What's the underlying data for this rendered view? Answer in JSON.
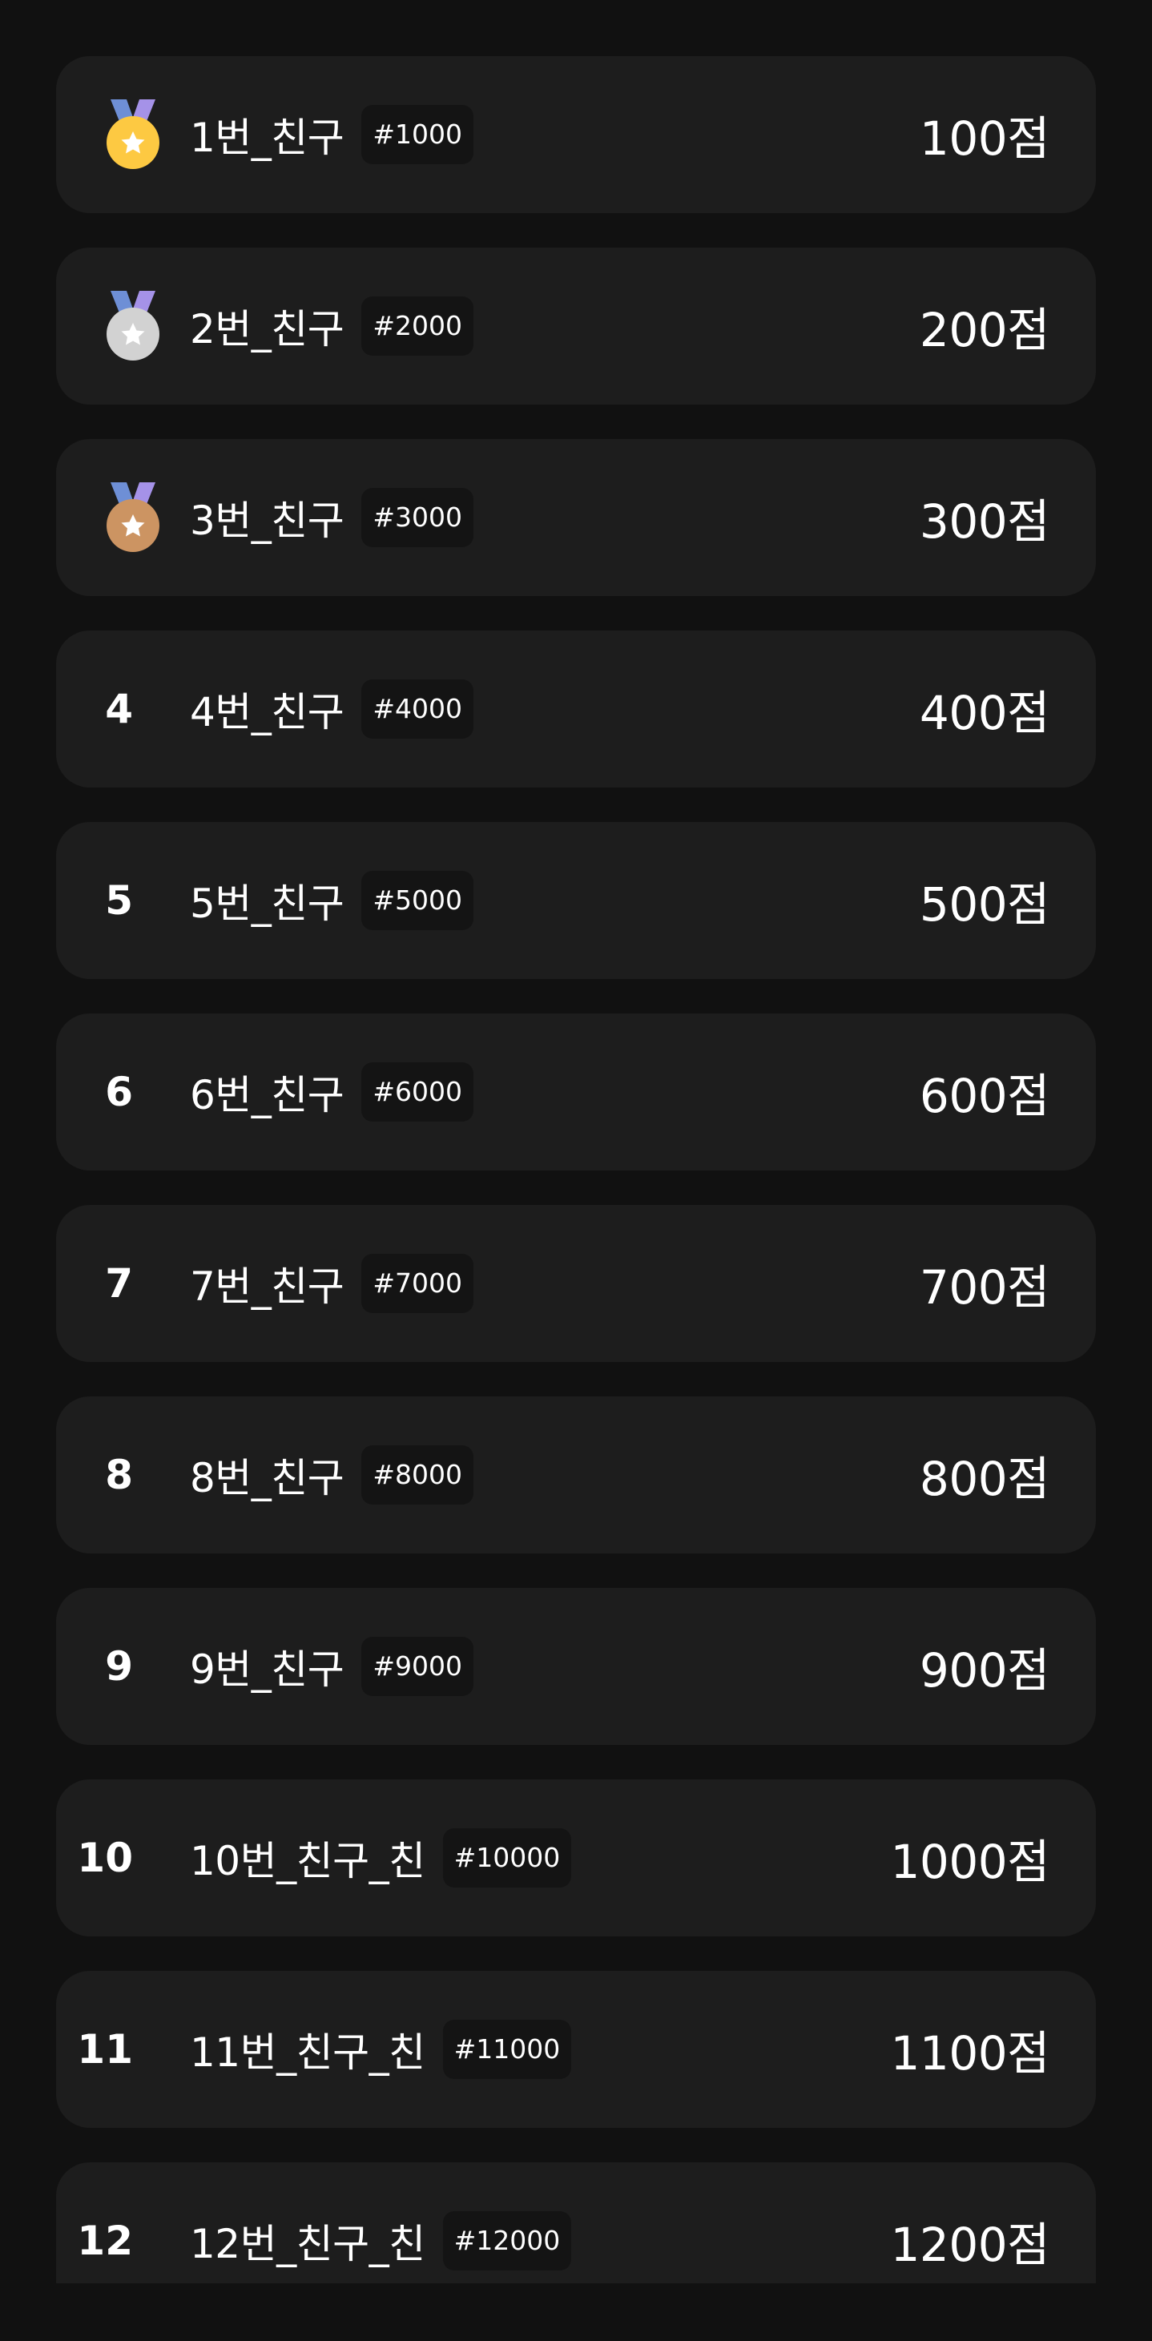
{
  "colors": {
    "background": "#111111",
    "row_background": "#1d1d1d",
    "tag_background": "#141414",
    "text": "#ffffff",
    "gold": "#fdc942",
    "silver": "#d2d2d2",
    "bronze": "#cc9462",
    "ribbon_left": "#6e8fd6",
    "ribbon_right": "#a592e8"
  },
  "leaderboard": {
    "entries": [
      {
        "rank": "1",
        "medal": "gold-medal-icon",
        "name": "1번_친구",
        "tag": "#1000",
        "score": "100점"
      },
      {
        "rank": "2",
        "medal": "silver-medal-icon",
        "name": "2번_친구",
        "tag": "#2000",
        "score": "200점"
      },
      {
        "rank": "3",
        "medal": "bronze-medal-icon",
        "name": "3번_친구",
        "tag": "#3000",
        "score": "300점"
      },
      {
        "rank": "4",
        "name": "4번_친구",
        "tag": "#4000",
        "score": "400점"
      },
      {
        "rank": "5",
        "name": "5번_친구",
        "tag": "#5000",
        "score": "500점"
      },
      {
        "rank": "6",
        "name": "6번_친구",
        "tag": "#6000",
        "score": "600점"
      },
      {
        "rank": "7",
        "name": "7번_친구",
        "tag": "#7000",
        "score": "700점"
      },
      {
        "rank": "8",
        "name": "8번_친구",
        "tag": "#8000",
        "score": "800점"
      },
      {
        "rank": "9",
        "name": "9번_친구",
        "tag": "#9000",
        "score": "900점"
      },
      {
        "rank": "10",
        "name": "10번_친구_친",
        "tag": "#10000",
        "score": "1000점"
      },
      {
        "rank": "11",
        "name": "11번_친구_친",
        "tag": "#11000",
        "score": "1100점"
      },
      {
        "rank": "12",
        "name": "12번_친구_친",
        "tag": "#12000",
        "score": "1200점"
      }
    ]
  }
}
